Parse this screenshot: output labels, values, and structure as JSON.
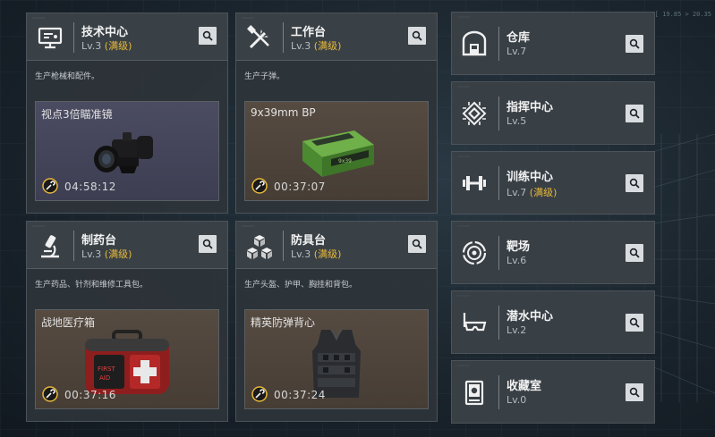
{
  "hud_text": "[ 19.85 > 20.35",
  "facilities_main": [
    {
      "name": "技术中心",
      "level": "Lv.3",
      "max_label": "(满级)",
      "icon": "monitor-icon",
      "description": "生产枪械和配件。",
      "product": {
        "name": "视点3倍瞄准镜",
        "time": "04:58:12",
        "theme": "blue",
        "image": "scope-icon"
      }
    },
    {
      "name": "工作台",
      "level": "Lv.3",
      "max_label": "(满级)",
      "icon": "tools-icon",
      "description": "生产子弹。",
      "product": {
        "name": "9x39mm BP",
        "time": "00:37:07",
        "theme": "brown",
        "image": "ammo-box-icon"
      }
    },
    {
      "name": "制药台",
      "level": "Lv.3",
      "max_label": "(满级)",
      "icon": "microscope-icon",
      "description": "生产药品、针剂和维修工具包。",
      "product": {
        "name": "战地医疗箱",
        "time": "00:37:16",
        "theme": "brown",
        "image": "medkit-icon"
      }
    },
    {
      "name": "防具台",
      "level": "Lv.3",
      "max_label": "(满级)",
      "icon": "cubes-icon",
      "description": "生产头盔、护甲、胸挂和背包。",
      "product": {
        "name": "精英防弹背心",
        "time": "00:37:24",
        "theme": "brown",
        "image": "vest-icon"
      }
    }
  ],
  "facilities_side": [
    {
      "name": "仓库",
      "level": "Lv.7",
      "max_label": "",
      "icon": "warehouse-icon"
    },
    {
      "name": "指挥中心",
      "level": "Lv.5",
      "max_label": "",
      "icon": "chip-icon"
    },
    {
      "name": "训练中心",
      "level": "Lv.7",
      "max_label": "(满级)",
      "icon": "dumbbell-icon"
    },
    {
      "name": "靶场",
      "level": "Lv.6",
      "max_label": "",
      "icon": "target-icon"
    },
    {
      "name": "潜水中心",
      "level": "Lv.2",
      "max_label": "",
      "icon": "diving-mask-icon"
    },
    {
      "name": "收藏室",
      "level": "Lv.0",
      "max_label": "",
      "icon": "collection-icon"
    }
  ],
  "colors": {
    "maxed": "#e8b93a",
    "panel": "#2e343a",
    "timer_ring": "#e8b93a"
  }
}
